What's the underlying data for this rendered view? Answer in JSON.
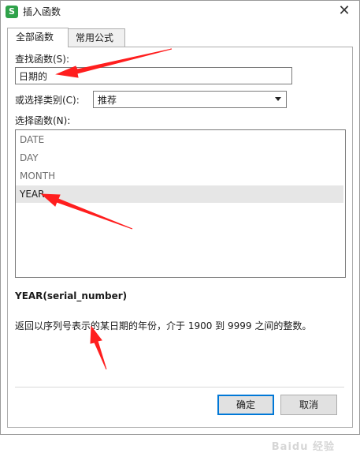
{
  "window": {
    "icon_glyph": "S",
    "title": "插入函数",
    "close_glyph": "✕"
  },
  "tabs": [
    {
      "label": "全部函数",
      "active": true
    },
    {
      "label": "常用公式",
      "active": false
    }
  ],
  "search": {
    "label": "查找函数(S):",
    "value": "日期的"
  },
  "category": {
    "label": "或选择类别(C):",
    "selected": "推荐"
  },
  "functions": {
    "label": "选择函数(N):",
    "items": [
      "DATE",
      "DAY",
      "MONTH",
      "YEAR"
    ],
    "selected_index": 3
  },
  "detail": {
    "signature": "YEAR(serial_number)",
    "description": "返回以序列号表示的某日期的年份，介于 1900 到 9999 之间的整数。"
  },
  "buttons": {
    "ok": "确定",
    "cancel": "取消"
  },
  "watermark": "Baidu 经验",
  "colors": {
    "annotation_arrow": "#ff1e1e",
    "app_icon": "#2fa24a",
    "selected_row": "#e6e6e6",
    "focus_border": "#0078d7"
  }
}
